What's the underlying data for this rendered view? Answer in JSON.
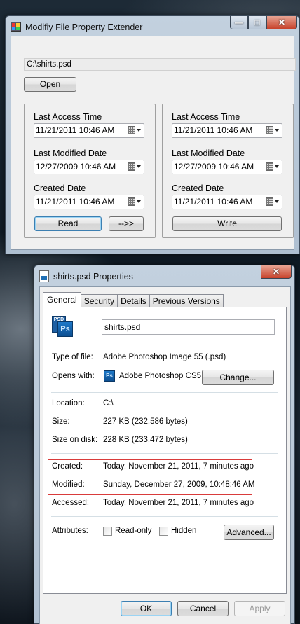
{
  "main_window": {
    "title": "Modifiy File Property Extender",
    "caption_min": "—",
    "caption_max": "□",
    "caption_close": "✕",
    "file_path": "C:\\shirts.psd",
    "open_button": "Open",
    "left_group": {
      "last_access_label": "Last Access Time",
      "last_access_value": "11/21/2011 10:46 AM",
      "last_modified_label": "Last Modified Date",
      "last_modified_value": "12/27/2009 10:46 AM",
      "created_label": "Created Date",
      "created_value": "11/21/2011 10:46 AM",
      "read_button": "Read",
      "copy_button": "-->>"
    },
    "right_group": {
      "last_access_label": "Last Access Time",
      "last_access_value": "11/21/2011 10:46 AM",
      "last_modified_label": "Last Modified Date",
      "last_modified_value": "12/27/2009 10:46 AM",
      "created_label": "Created Date",
      "created_value": "11/21/2011 10:46 AM",
      "write_button": "Write"
    }
  },
  "properties_dialog": {
    "title": "shirts.psd Properties",
    "caption_close": "✕",
    "tabs": [
      "General",
      "Security",
      "Details",
      "Previous Versions"
    ],
    "active_tab": "General",
    "icon_top": "PSD",
    "icon_text": "Ps",
    "file_name": "shirts.psd",
    "type_label": "Type of file:",
    "type_value": "Adobe Photoshop Image 55 (.psd)",
    "opens_label": "Opens with:",
    "opens_value": "Adobe Photoshop CS5.",
    "change_button": "Change...",
    "location_label": "Location:",
    "location_value": "C:\\",
    "size_label": "Size:",
    "size_value": "227 KB (232,586 bytes)",
    "size_disk_label": "Size on disk:",
    "size_disk_value": "228 KB (233,472 bytes)",
    "created_label": "Created:",
    "created_value": "Today, November 21, 2011, 7 minutes ago",
    "modified_label": "Modified:",
    "modified_value": "Sunday, December 27, 2009, 10:48:46 AM",
    "accessed_label": "Accessed:",
    "accessed_value": "Today, November 21, 2011, 7 minutes ago",
    "attributes_label": "Attributes:",
    "readonly_label": "Read-only",
    "hidden_label": "Hidden",
    "advanced_button": "Advanced...",
    "ok_button": "OK",
    "cancel_button": "Cancel",
    "apply_button": "Apply"
  }
}
